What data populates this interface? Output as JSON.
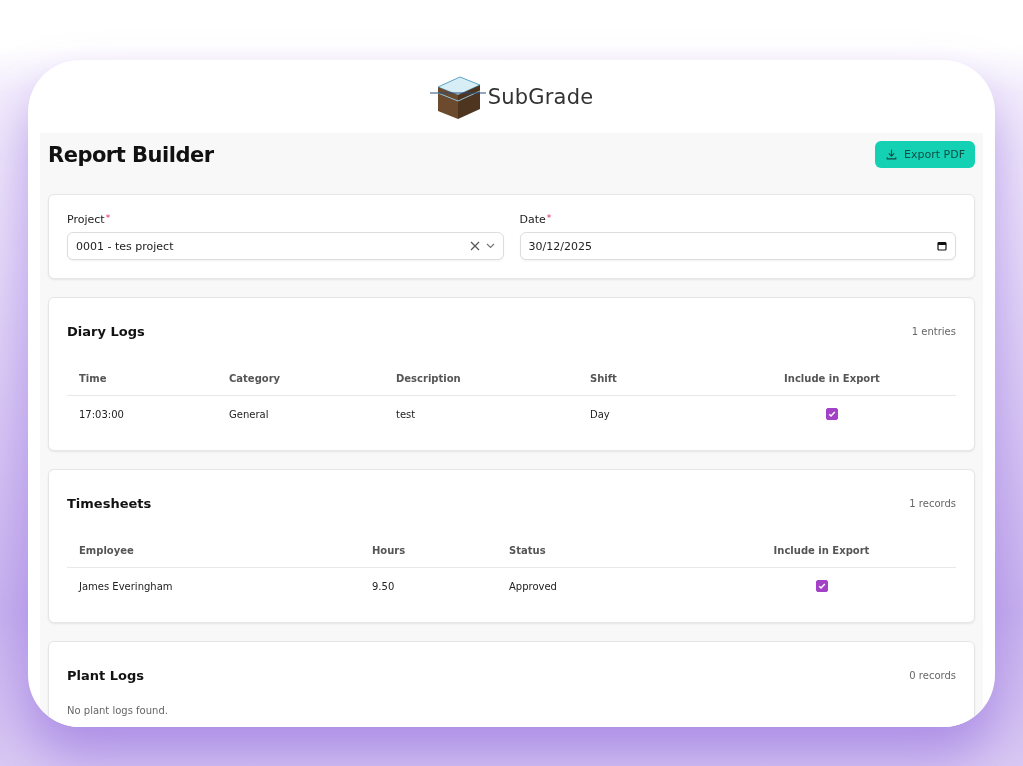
{
  "brand": {
    "name": "SubGrade"
  },
  "page": {
    "title": "Report Builder",
    "export_button": "Export PDF"
  },
  "filters": {
    "project": {
      "label": "Project",
      "required_mark": "*",
      "value": "0001 - tes project"
    },
    "date": {
      "label": "Date",
      "required_mark": "*",
      "value": "30/12/2025"
    }
  },
  "sections": [
    {
      "title": "Diary Logs",
      "count": "1 entries",
      "columns": [
        "Time",
        "Category",
        "Description",
        "Shift",
        "Include in Export"
      ],
      "rows": [
        {
          "cells": [
            "17:03:00",
            "General",
            "test",
            "Day"
          ],
          "include": true
        }
      ]
    },
    {
      "title": "Timesheets",
      "count": "1 records",
      "columns": [
        "Employee",
        "Hours",
        "Status",
        "Include in Export"
      ],
      "rows": [
        {
          "cells": [
            "James Everingham",
            "9.50",
            "Approved"
          ],
          "include": true
        }
      ]
    },
    {
      "title": "Plant Logs",
      "count": "0 records",
      "empty": "No plant logs found."
    }
  ]
}
